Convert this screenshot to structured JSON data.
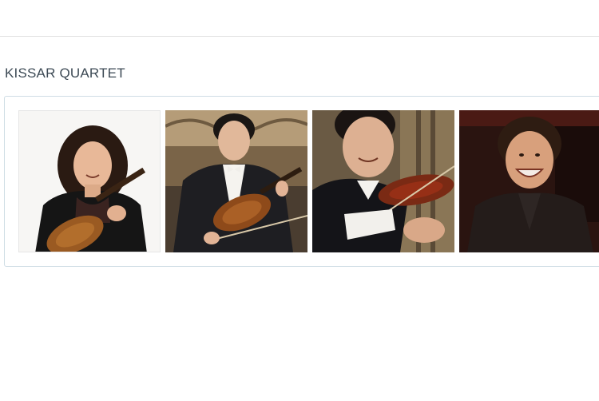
{
  "ensemble": {
    "title": "KISSAR QUARTET"
  },
  "gallery": {
    "photos": [
      {
        "icon": "portrait-violinist-woman"
      },
      {
        "icon": "portrait-violinist-man-formal"
      },
      {
        "icon": "portrait-violinist-man-closeup"
      },
      {
        "icon": "portrait-musician-man-smiling"
      }
    ]
  }
}
